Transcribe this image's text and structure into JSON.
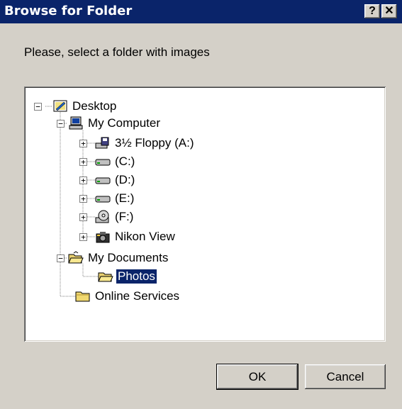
{
  "window": {
    "title": "Browse for Folder",
    "help_glyph": "?",
    "close_glyph": "✕"
  },
  "prompt": "Please, select a folder with images",
  "tree": {
    "desktop": "Desktop",
    "my_computer": "My Computer",
    "floppy": "3½ Floppy (A:)",
    "drive_c": "(C:)",
    "drive_d": "(D:)",
    "drive_e": "(E:)",
    "drive_f": "(F:)",
    "nikon_view": "Nikon View",
    "my_documents": "My Documents",
    "photos": "Photos",
    "online_services": "Online Services",
    "selected": "Photos"
  },
  "buttons": {
    "ok": "OK",
    "cancel": "Cancel"
  },
  "colors": {
    "titlebar": "#0a246a",
    "face": "#d4d0c8",
    "selection": "#0a246a"
  }
}
